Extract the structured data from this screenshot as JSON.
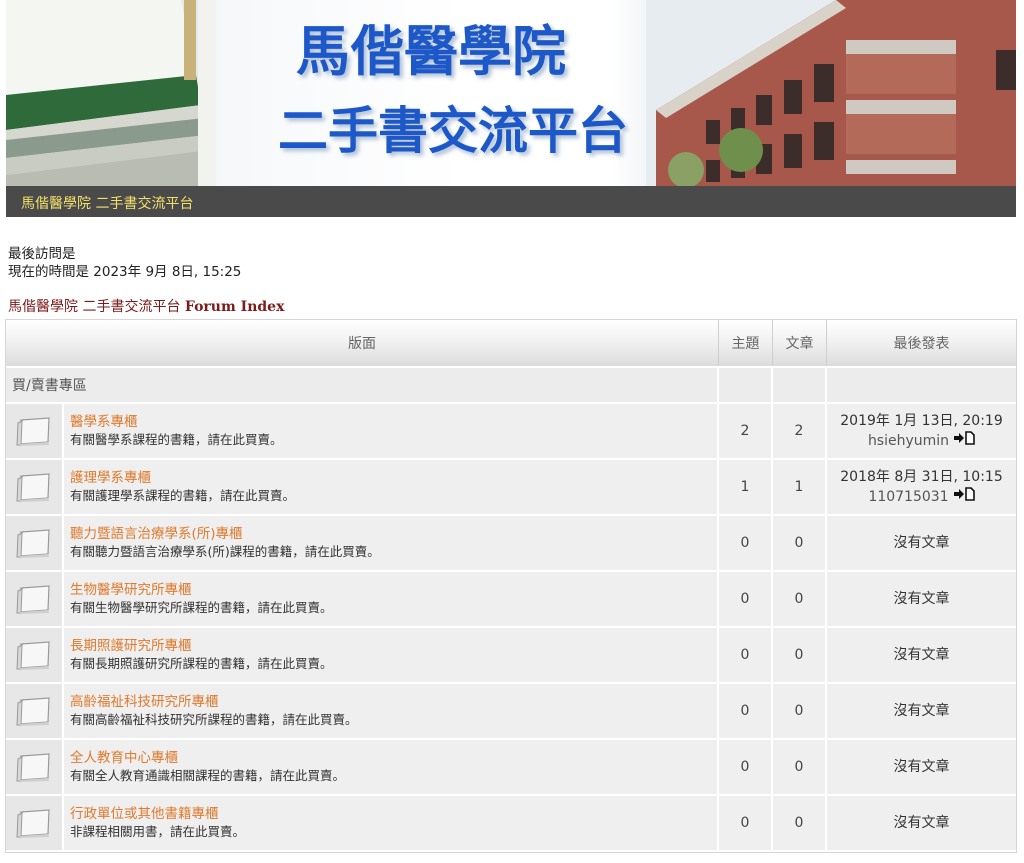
{
  "banner": {
    "title_line1": "馬偕醫學院",
    "title_line2": "二手書交流平台"
  },
  "sitebar": {
    "link": "馬偕醫學院 二手書交流平台"
  },
  "info": {
    "last_visit": "最後訪問是",
    "now": "現在的時間是 2023年 9月 8日, 15:25"
  },
  "breadcrumb": {
    "site": "馬偕醫學院 二手書交流平台",
    "index": "Forum Index"
  },
  "table": {
    "headers": {
      "forum": "版面",
      "topics": "主題",
      "posts": "文章",
      "last": "最後發表"
    },
    "category": "買/賣書專區",
    "forums": [
      {
        "name": "醫學系專櫃",
        "desc": "有關醫學系課程的書籍，請在此買賣。",
        "topics": "2",
        "posts": "2",
        "last_date": "2019年 1月 13日, 20:19",
        "last_user": "hsiehyumin"
      },
      {
        "name": "護理學系專櫃",
        "desc": "有關護理學系課程的書籍，請在此買賣。",
        "topics": "1",
        "posts": "1",
        "last_date": "2018年 8月 31日, 10:15",
        "last_user": "110715031"
      },
      {
        "name": "聽力暨語言治療學系(所)專櫃",
        "desc": "有關聽力暨語言治療學系(所)課程的書籍，請在此買賣。",
        "topics": "0",
        "posts": "0",
        "no_posts": "沒有文章"
      },
      {
        "name": "生物醫學研究所專櫃",
        "desc": "有關生物醫學研究所課程的書籍，請在此買賣。",
        "topics": "0",
        "posts": "0",
        "no_posts": "沒有文章"
      },
      {
        "name": "長期照護研究所專櫃",
        "desc": "有關長期照護研究所課程的書籍，請在此買賣。",
        "topics": "0",
        "posts": "0",
        "no_posts": "沒有文章"
      },
      {
        "name": "高齡福祉科技研究所專櫃",
        "desc": "有關高齡福祉科技研究所課程的書籍，請在此買賣。",
        "topics": "0",
        "posts": "0",
        "no_posts": "沒有文章"
      },
      {
        "name": "全人教育中心專櫃",
        "desc": "有關全人教育通識相關課程的書籍，請在此買賣。",
        "topics": "0",
        "posts": "0",
        "no_posts": "沒有文章"
      },
      {
        "name": "行政單位或其他書籍專櫃",
        "desc": "非課程相關用書，請在此買賣。",
        "topics": "0",
        "posts": "0",
        "no_posts": "沒有文章"
      }
    ]
  },
  "icons": {
    "folder": "forum-folder-icon",
    "goto": "goto-last-post-icon"
  }
}
